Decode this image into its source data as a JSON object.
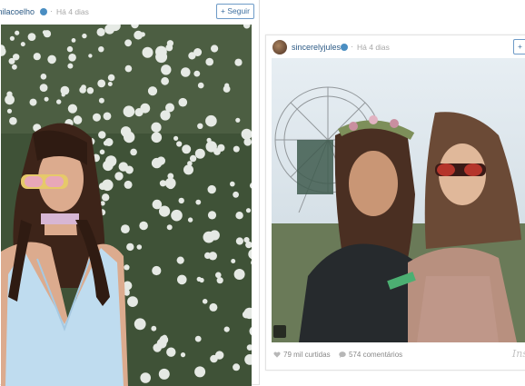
{
  "posts": [
    {
      "username": "milacoelho",
      "time": "Há 4 dias",
      "follow_label": "+ Seguir"
    },
    {
      "username": "sincerelyjules",
      "time": "Há 4 dias",
      "follow_label": "+",
      "likes": "79 mil curtidas",
      "comments": "574 comentários",
      "brand": "Ins"
    }
  ]
}
